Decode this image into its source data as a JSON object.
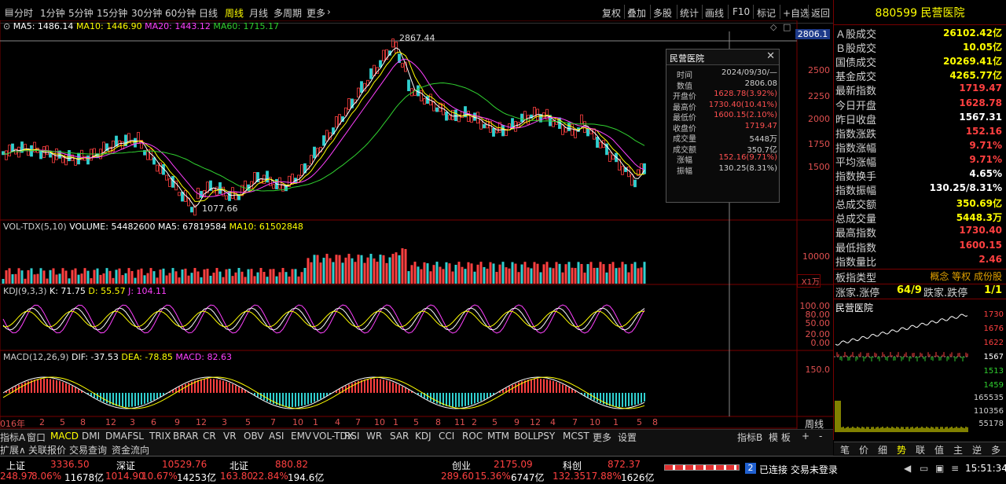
{
  "toolbar": {
    "periods": [
      "分时",
      "1分钟",
      "5分钟",
      "15分钟",
      "30分钟",
      "60分钟",
      "日线",
      "周线",
      "月线",
      "多周期",
      "更多"
    ],
    "active_period": "周线",
    "actions": [
      "复权",
      "叠加",
      "多股",
      "统计",
      "画线",
      "F10",
      "标记",
      "+自选",
      "返回"
    ]
  },
  "main": {
    "ma_label_prefix": "⊙",
    "ma5": "MA5: 1486.14",
    "ma10": "MA10: 1446.90",
    "ma20": "MA20: 1443.12",
    "ma60": "MA60: 1715.17",
    "high_label": "2867.44",
    "low_label": "1077.66",
    "cursor_price": "2806.1",
    "axis": [
      "2500",
      "2250",
      "2000",
      "1750",
      "1500"
    ]
  },
  "vol": {
    "title": "VOL-TDX(5,10)",
    "volume": "VOLUME: 54482600",
    "ma5": "MA5: 67819584",
    "ma10": "MA10: 61502848",
    "axis": "10000",
    "unit": "X1万"
  },
  "kdj": {
    "title": "KDJ(9,3,3)",
    "k": "K: 71.75",
    "d": "D: 55.57",
    "j": "J: 104.11",
    "axis": [
      "100.00",
      "80.00",
      "50.00",
      "20.00",
      "0.00"
    ]
  },
  "macd": {
    "title": "MACD(12,26,9)",
    "dif": "DIF: -37.53",
    "dea": "DEA: -78.85",
    "macd": "MACD: 82.63",
    "axis": "150.0"
  },
  "xaxis": {
    "labels": [
      "016年",
      "2",
      "5",
      "8",
      "12",
      "3",
      "6",
      "9",
      "12",
      "3",
      "5",
      "7",
      "10",
      "1",
      "4",
      "7",
      "10",
      "1",
      "5",
      "8",
      "11",
      "2",
      "5",
      "9",
      "12",
      "4",
      "7",
      "10",
      "1",
      "5",
      "8"
    ],
    "right": "周线"
  },
  "popup": {
    "title": "民营医院",
    "rows": [
      {
        "l": "时间",
        "v": "2024/09/30/—"
      },
      {
        "l": "数值",
        "v": "2806.08"
      },
      {
        "l": "开盘价",
        "v": "1628.78(3.92%)"
      },
      {
        "l": "最高价",
        "v": "1730.40(10.41%)"
      },
      {
        "l": "最低价",
        "v": "1600.15(2.10%)"
      },
      {
        "l": "收盘价",
        "v": "1719.47"
      },
      {
        "l": "成交量",
        "v": "5448万"
      },
      {
        "l": "成交额",
        "v": "350.7亿"
      },
      {
        "l": "涨幅",
        "v": "152.16(9.71%)"
      },
      {
        "l": "振幅",
        "v": "130.25(8.31%)"
      }
    ]
  },
  "panel": {
    "code": "880599",
    "name": "民营医院",
    "rows": [
      {
        "l": "Ａ股成交",
        "v": "26102.42亿",
        "c": "yellow"
      },
      {
        "l": "Ｂ股成交",
        "v": "10.05亿",
        "c": "yellow"
      },
      {
        "l": "国债成交",
        "v": "20269.41亿",
        "c": "yellow"
      },
      {
        "l": "基金成交",
        "v": "4265.77亿",
        "c": "yellow"
      },
      {
        "l": "最新指数",
        "v": "1719.47",
        "c": "red"
      },
      {
        "l": "今日开盘",
        "v": "1628.78",
        "c": "red"
      },
      {
        "l": "昨日收盘",
        "v": "1567.31",
        "c": "white"
      },
      {
        "l": "指数涨跌",
        "v": "152.16",
        "c": "red"
      },
      {
        "l": "指数涨幅",
        "v": "9.71%",
        "c": "red"
      },
      {
        "l": "平均涨幅",
        "v": "9.71%",
        "c": "red"
      },
      {
        "l": "指数换手",
        "v": "4.65%",
        "c": "white"
      },
      {
        "l": "指数振幅",
        "v": "130.25/8.31%",
        "c": "white"
      },
      {
        "l": "总成交额",
        "v": "350.69亿",
        "c": "yellow"
      },
      {
        "l": "总成交量",
        "v": "5448.3万",
        "c": "yellow"
      },
      {
        "l": "最高指数",
        "v": "1730.40",
        "c": "red"
      },
      {
        "l": "最低指数",
        "v": "1600.15",
        "c": "red"
      },
      {
        "l": "指数量比",
        "v": "2.46",
        "c": "red"
      }
    ],
    "board_type_label": "板指类型",
    "board_type_value": "概念 等权 成份股",
    "updown_label": "涨家.涨停",
    "updown_value": "64/9",
    "down_label": "跌家.跌停",
    "down_value": "1/1",
    "mini_title": "民营医院",
    "mini_axis": [
      "1730",
      "1676",
      "1622",
      "1567",
      "1513",
      "1459",
      "165535",
      "110356",
      "55178"
    ],
    "mini_tabs": [
      "笔",
      "价",
      "细",
      "势",
      "联",
      "值",
      "主",
      "逆",
      "多"
    ]
  },
  "tabs": [
    "指标A",
    "窗口",
    "MACD",
    "DMI",
    "DMA",
    "FSL",
    "TRIX",
    "BRAR",
    "CR",
    "VR",
    "OBV",
    "ASI",
    "EMV",
    "VOL-TDX",
    "RSI",
    "WR",
    "SAR",
    "KDJ",
    "CCI",
    "ROC",
    "MTM",
    "BOLL",
    "PSY",
    "MCST",
    "更多",
    "设置"
  ],
  "tabs_right": [
    "指标B",
    "模 板",
    "+",
    "-"
  ],
  "tabs2": [
    "扩展∧",
    "关联报价",
    "交易查询",
    "资金流向"
  ],
  "status": {
    "sh": {
      "name": "上证",
      "price": "3336.50",
      "chg": "248.97",
      "pct": "8.06%",
      "amt": "11678亿"
    },
    "sz": {
      "name": "深证",
      "price": "10529.76",
      "chg": "1014.90",
      "pct": "10.67%",
      "amt": "14253亿"
    },
    "bz": {
      "name": "北证",
      "price": "880.82",
      "chg": "163.80",
      "pct": "22.84%",
      "amt": "194.6亿"
    },
    "cy": {
      "name": "创业",
      "price": "2175.09",
      "chg": "289.60",
      "pct": "15.36%",
      "amt": "6747亿"
    },
    "kc": {
      "name": "科创",
      "price": "872.37",
      "chg": "132.35",
      "pct": "17.88%",
      "amt": "1626亿"
    },
    "conn": "已连接 交易未登录",
    "conn_num": "2",
    "time": "15:51:34"
  },
  "colors": {
    "up": "#ff4040",
    "down": "#30d0d0",
    "ma5": "#ffffff",
    "ma10": "#ffff00",
    "ma20": "#ff40ff",
    "ma60": "#30d030"
  }
}
